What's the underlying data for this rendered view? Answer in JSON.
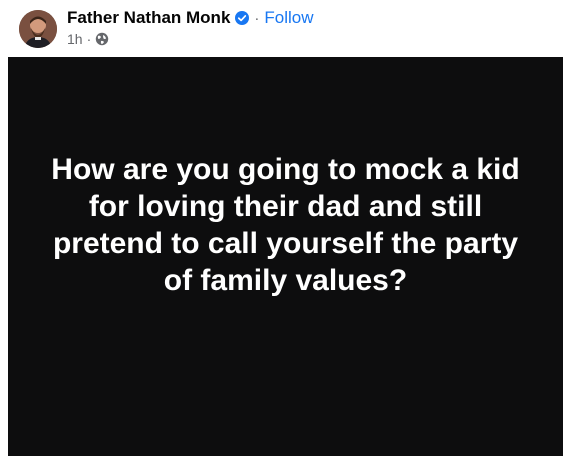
{
  "post": {
    "author": "Father Nathan Monk",
    "verified_icon": "verified-badge-icon",
    "separator": "·",
    "follow_label": "Follow",
    "time": "1h",
    "meta_separator": "·",
    "audience_icon": "globe-icon",
    "text": "How are you going to mock a kid for loving their dad and still pretend to call yourself the party of family values?"
  },
  "colors": {
    "background_post": "#0d0d0e",
    "text": "#ffffff",
    "link_blue": "#1877f2",
    "secondary": "#65676b"
  }
}
